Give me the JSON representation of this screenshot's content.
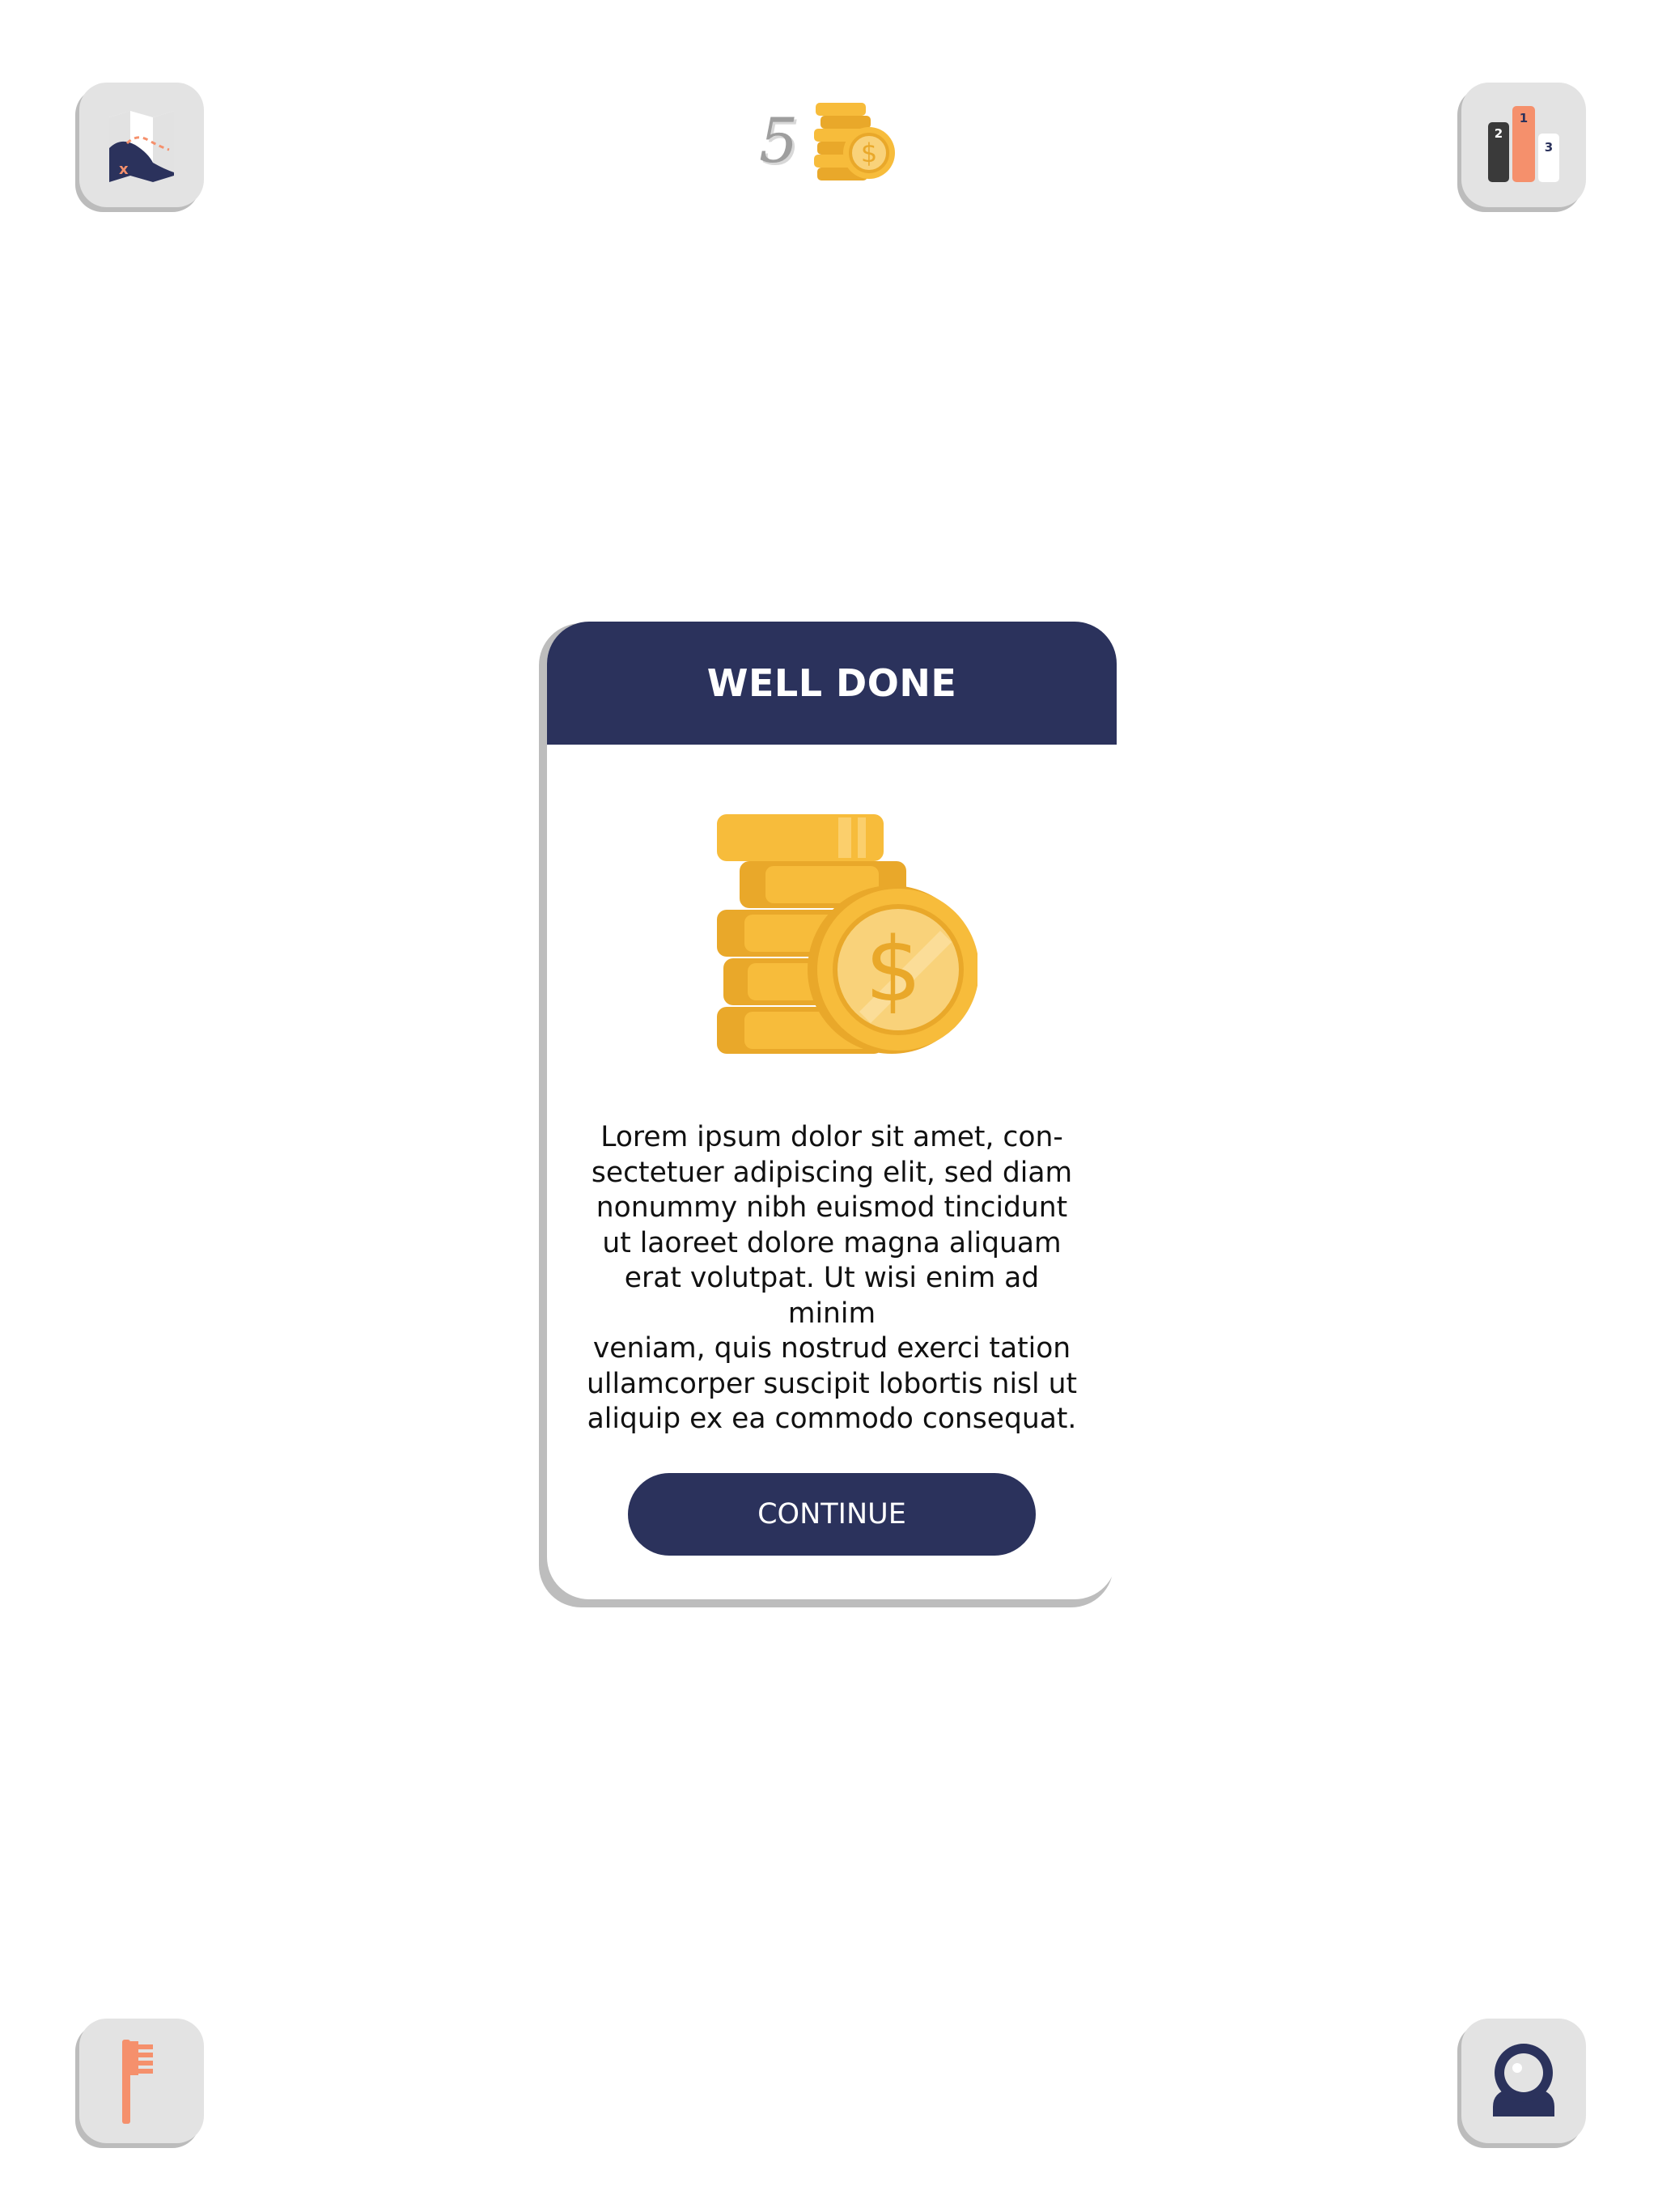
{
  "hud": {
    "coin_count": "5",
    "coin_icon": "coin-stack-icon"
  },
  "corner_buttons": {
    "top_left_icon": "treasure-map-icon",
    "top_right_icon": "podium-leaderboard-icon",
    "bottom_left_icon": "flag-icon",
    "bottom_right_icon": "user-profile-icon",
    "podium_labels": [
      "1",
      "2",
      "3"
    ]
  },
  "modal": {
    "title": "WELL DONE",
    "illustration_icon": "dollar-coin-stack-icon",
    "body": "Lorem ipsum dolor sit amet, con-\nsectetuer adipiscing elit, sed diam\nnonummy nibh euismod tincidunt\nut laoreet dolore magna aliquam\nerat volutpat. Ut wisi enim ad minim\nveniam, quis nostrud exerci tation\nullamcorper suscipit lobortis nisl ut\naliquip ex ea commodo consequat.",
    "continue_label": "CONTINUE"
  },
  "colors": {
    "navy": "#2b325c",
    "coin_gold": "#f7bc3b",
    "coin_dark": "#e9a82a",
    "accent_orange": "#f5906c",
    "button_gray": "#e3e3e3"
  }
}
